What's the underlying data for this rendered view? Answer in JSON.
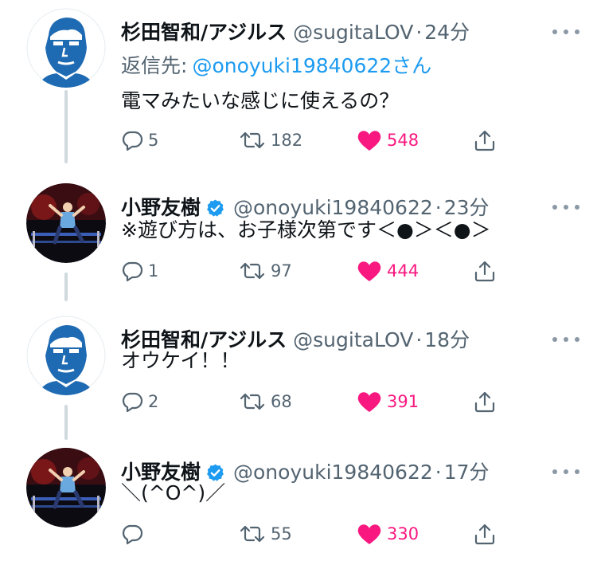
{
  "tweets": [
    {
      "name": "杉田智和/アジルス",
      "verified": false,
      "handle": "@sugitaLOV",
      "sep": "·",
      "time": "24分",
      "reply_prefix": "返信先:",
      "reply_mention": "@onoyuki19840622さん",
      "text": "電マみたいな感じに使えるの？",
      "replies": "5",
      "retweets": "182",
      "likes": "548",
      "avatar": "sugita-avatar"
    },
    {
      "name": "小野友樹",
      "verified": true,
      "handle": "@onoyuki19840622",
      "sep": "·",
      "time": "23分",
      "text": "※遊び方は、お子様次第です＜●＞＜●＞",
      "replies": "1",
      "retweets": "97",
      "likes": "444",
      "avatar": "ono-avatar"
    },
    {
      "name": "杉田智和/アジルス",
      "verified": false,
      "handle": "@sugitaLOV",
      "sep": "·",
      "time": "18分",
      "text": "オウケイ！！",
      "replies": "2",
      "retweets": "68",
      "likes": "391",
      "avatar": "sugita-avatar"
    },
    {
      "name": "小野友樹",
      "verified": true,
      "handle": "@onoyuki19840622",
      "sep": "·",
      "time": "17分",
      "text": "＼(^O^)／",
      "replies": "",
      "retweets": "55",
      "likes": "330",
      "avatar": "ono-avatar"
    }
  ],
  "colors": {
    "text": "#0f1419",
    "secondary": "#536471",
    "link": "#1d9bf0",
    "like": "#f91880",
    "thread_line": "#cfd9de"
  },
  "icons": {
    "reply": "reply-icon",
    "retweet": "retweet-icon",
    "like": "heart-icon",
    "share": "share-icon",
    "more": "more-icon",
    "verified": "verified-badge-icon"
  }
}
